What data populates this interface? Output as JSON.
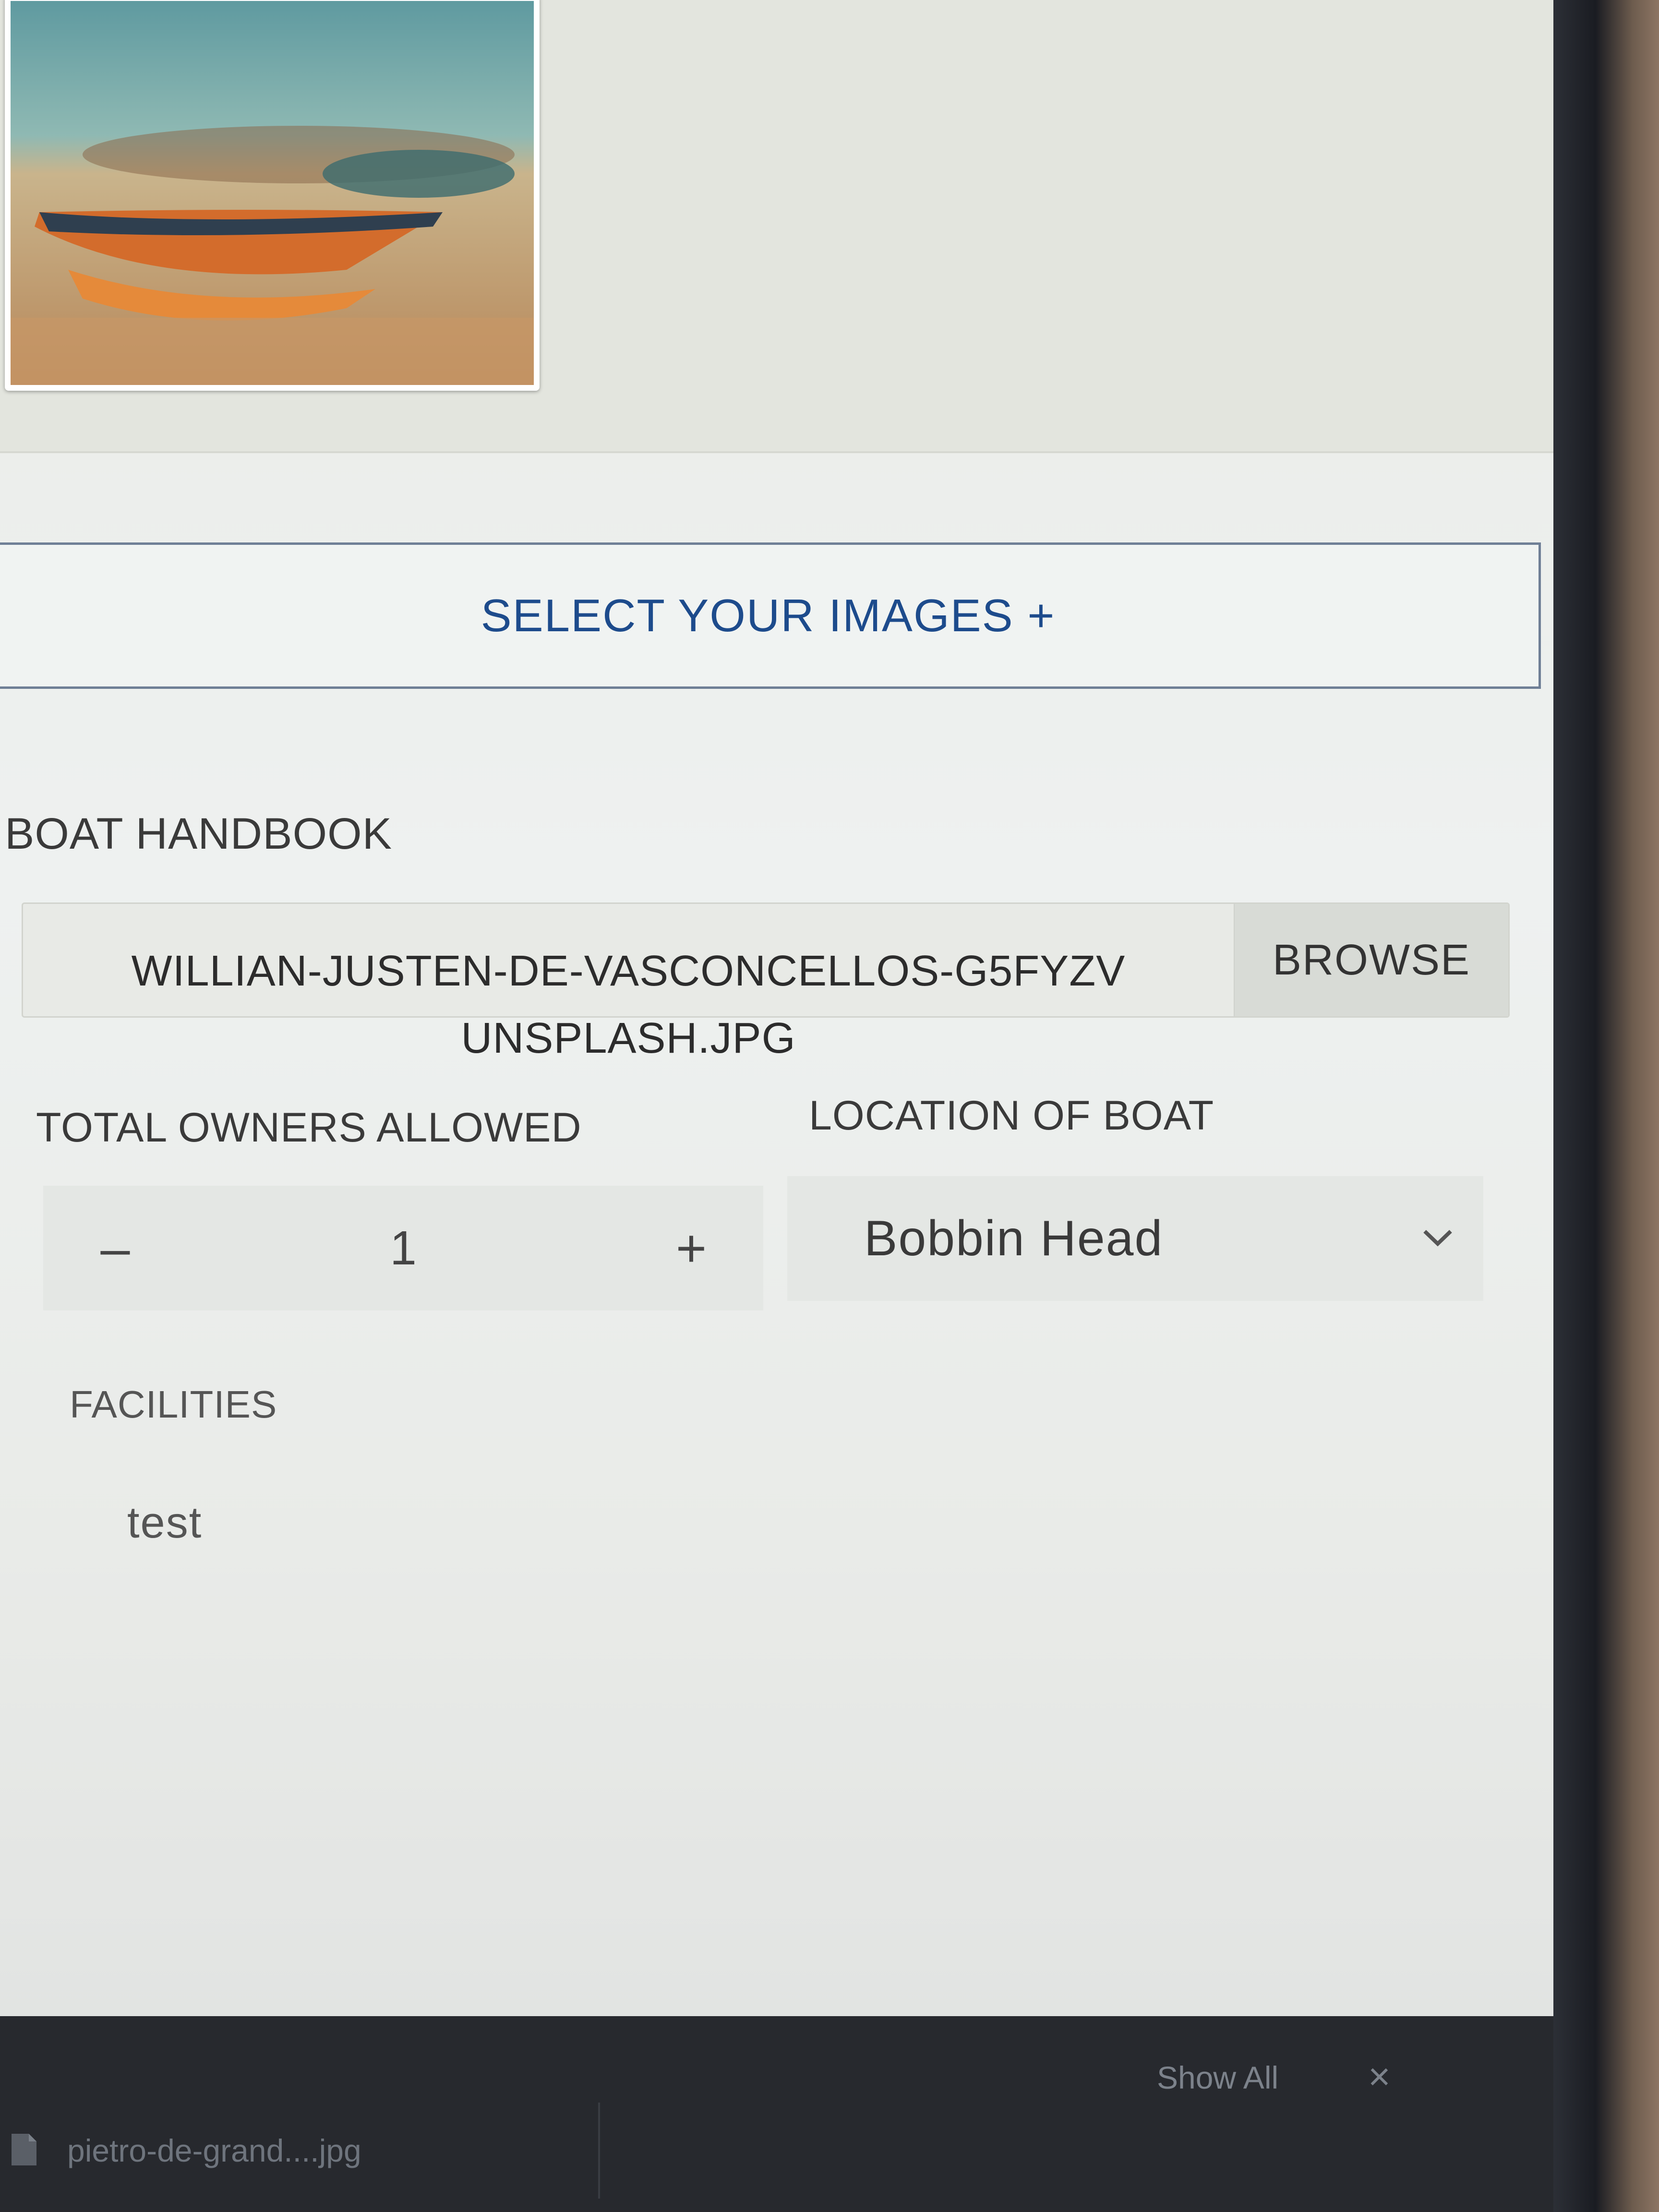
{
  "upload": {
    "select_label": "SELECT YOUR IMAGES +"
  },
  "handbook": {
    "label": "BOAT HANDBOOK",
    "file_name": "WILLIAN-JUSTEN-DE-VASCONCELLOS-G5FYZV\nUNSPLASH.JPG",
    "browse_label": "BROWSE"
  },
  "owners": {
    "label": "TOTAL OWNERS ALLOWED",
    "minus_label": "–",
    "value": "1",
    "plus_label": "+"
  },
  "location": {
    "label": "LOCATION OF BOAT",
    "value": "Bobbin Head"
  },
  "facilities": {
    "label": "FACILITIES",
    "value": "test"
  },
  "downloads": {
    "file_name": "pietro-de-grand....jpg",
    "show_all_label": "Show All",
    "close_label": "×"
  },
  "colors": {
    "accent": "#1d4b8c",
    "background": "#eef1f0"
  },
  "icons": [
    "boat-photo",
    "chevron-down-icon",
    "file-icon",
    "close-icon"
  ]
}
